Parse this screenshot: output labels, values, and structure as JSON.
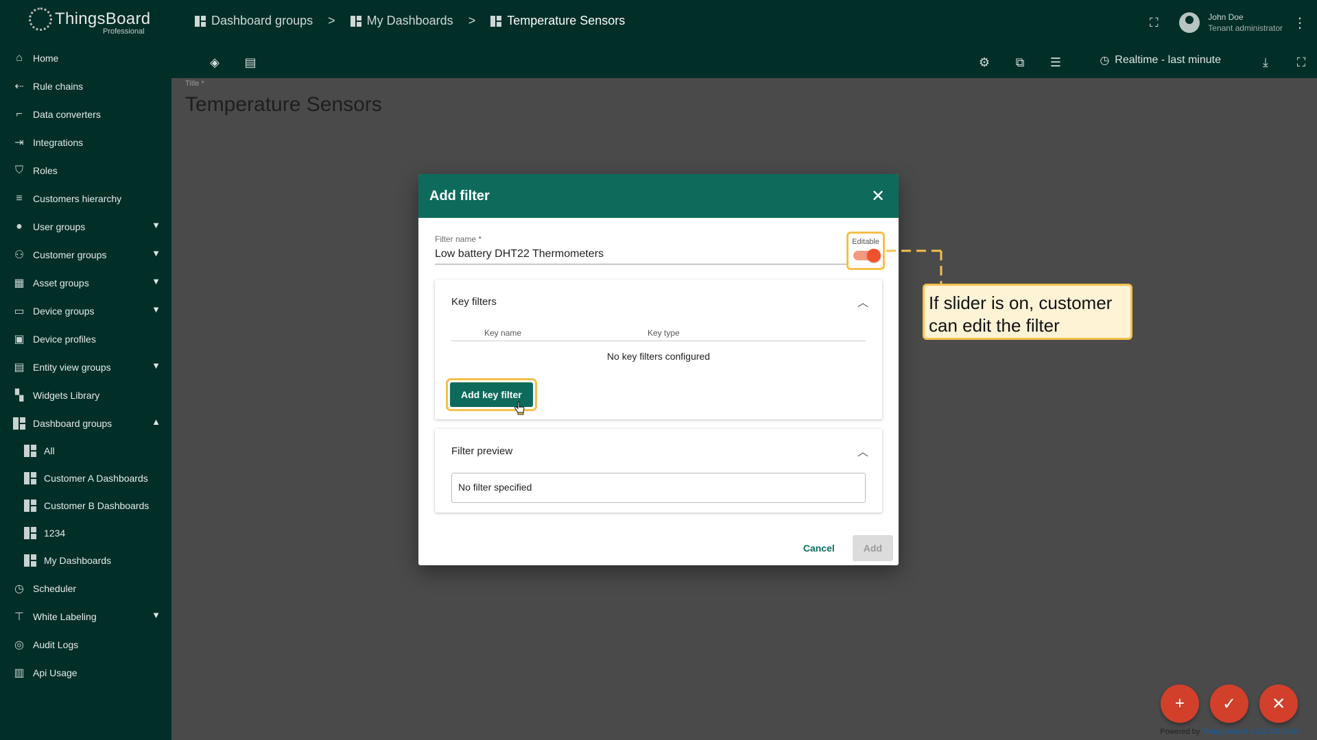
{
  "app": {
    "name": "ThingsBoard",
    "edition": "Professional"
  },
  "breadcrumb": {
    "items": [
      "Dashboard groups",
      "My Dashboards",
      "Temperature Sensors"
    ],
    "separator": ">"
  },
  "user": {
    "name": "John Doe",
    "role": "Tenant administrator"
  },
  "toolbar": {
    "timewindow": "Realtime - last minute"
  },
  "sidebar": {
    "items": [
      {
        "label": "Home",
        "icon": "home-icon"
      },
      {
        "label": "Rule chains",
        "icon": "rule-chain-icon"
      },
      {
        "label": "Data converters",
        "icon": "converter-icon"
      },
      {
        "label": "Integrations",
        "icon": "integration-icon"
      },
      {
        "label": "Roles",
        "icon": "shield-icon"
      },
      {
        "label": "Customers hierarchy",
        "icon": "hierarchy-icon"
      },
      {
        "label": "User groups",
        "icon": "account-icon",
        "expand": "down"
      },
      {
        "label": "Customer groups",
        "icon": "group-icon",
        "expand": "down"
      },
      {
        "label": "Asset groups",
        "icon": "building-icon",
        "expand": "down"
      },
      {
        "label": "Device groups",
        "icon": "devices-icon",
        "expand": "down"
      },
      {
        "label": "Device profiles",
        "icon": "device-profile-icon"
      },
      {
        "label": "Entity view groups",
        "icon": "view-icon",
        "expand": "down"
      },
      {
        "label": "Widgets Library",
        "icon": "widgets-icon"
      },
      {
        "label": "Dashboard groups",
        "icon": "dashboard-icon",
        "expand": "up"
      }
    ],
    "sub_items": [
      "All",
      "Customer A Dashboards",
      "Customer B Dashboards",
      "1234",
      "My Dashboards"
    ],
    "bottom_items": [
      {
        "label": "Scheduler",
        "icon": "clock-icon"
      },
      {
        "label": "White Labeling",
        "icon": "paint-roller-icon",
        "expand": "down"
      },
      {
        "label": "Audit Logs",
        "icon": "audit-icon"
      },
      {
        "label": "Api Usage",
        "icon": "chart-icon"
      }
    ]
  },
  "dashboard": {
    "title_label": "Title *",
    "title": "Temperature Sensors"
  },
  "dialog": {
    "title": "Add filter",
    "filter_name_label": "Filter name *",
    "filter_name_value": "Low battery DHT22 Thermometers",
    "editable_label": "Editable",
    "editable_on": true,
    "key_filters": {
      "title": "Key filters",
      "col_key_name": "Key name",
      "col_key_type": "Key type",
      "empty_text": "No key filters configured",
      "add_button": "Add key filter"
    },
    "filter_preview": {
      "title": "Filter preview",
      "text": "No filter specified"
    },
    "cancel_button": "Cancel",
    "add_button": "Add"
  },
  "callout": {
    "text": "If slider is on, customer can edit the filter"
  },
  "footer": {
    "powered_prefix": "Powered by",
    "powered_link": "Thingsboard v.3.2.2CLOUD"
  },
  "colors": {
    "primary": "#0e6b5c",
    "sidebar": "#022e28",
    "accent": "#f0522c",
    "highlight": "#f4c04a"
  }
}
